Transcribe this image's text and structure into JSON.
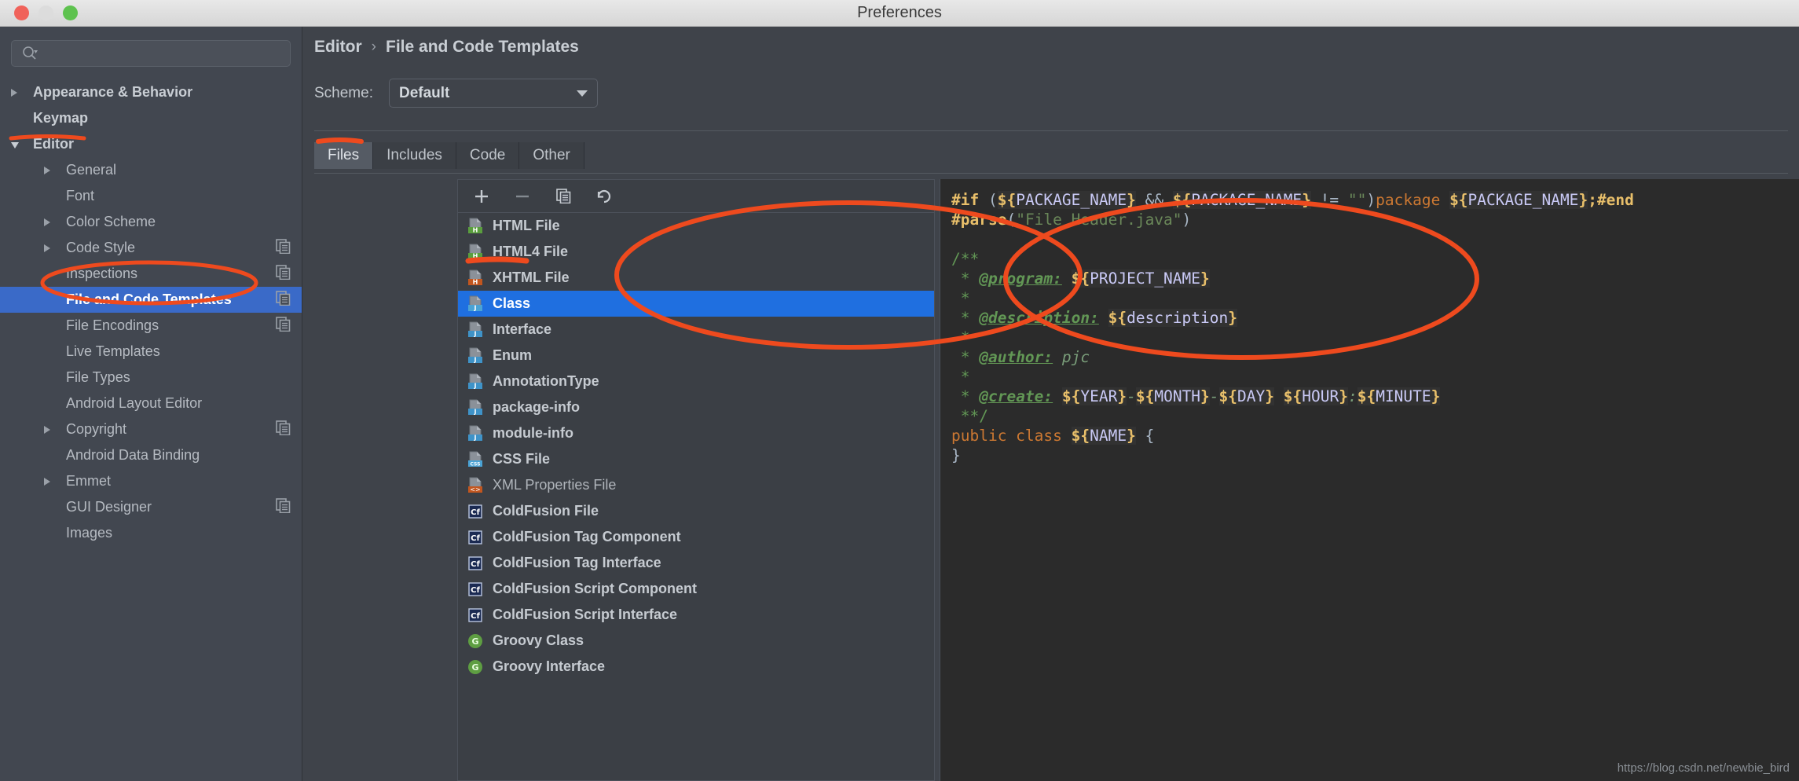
{
  "window": {
    "title": "Preferences",
    "traffic_lights": [
      "close-button",
      "minimize-button",
      "zoom-button"
    ]
  },
  "sidebar": {
    "search": {
      "value": "",
      "placeholder": ""
    },
    "items": [
      {
        "label": "Appearance & Behavior",
        "indent": 0,
        "arrow": "right",
        "bold": true,
        "selected": false,
        "copy": false
      },
      {
        "label": "Keymap",
        "indent": 0,
        "arrow": "none",
        "bold": true,
        "selected": false,
        "copy": false
      },
      {
        "label": "Editor",
        "indent": 0,
        "arrow": "down",
        "bold": true,
        "selected": false,
        "copy": false
      },
      {
        "label": "General",
        "indent": 1,
        "arrow": "right",
        "bold": false,
        "selected": false,
        "copy": false
      },
      {
        "label": "Font",
        "indent": 1,
        "arrow": "none",
        "bold": false,
        "selected": false,
        "copy": false
      },
      {
        "label": "Color Scheme",
        "indent": 1,
        "arrow": "right",
        "bold": false,
        "selected": false,
        "copy": false
      },
      {
        "label": "Code Style",
        "indent": 1,
        "arrow": "right",
        "bold": false,
        "selected": false,
        "copy": true
      },
      {
        "label": "Inspections",
        "indent": 1,
        "arrow": "none",
        "bold": false,
        "selected": false,
        "copy": true
      },
      {
        "label": "File and Code Templates",
        "indent": 1,
        "arrow": "none",
        "bold": false,
        "selected": true,
        "copy": true
      },
      {
        "label": "File Encodings",
        "indent": 1,
        "arrow": "none",
        "bold": false,
        "selected": false,
        "copy": true
      },
      {
        "label": "Live Templates",
        "indent": 1,
        "arrow": "none",
        "bold": false,
        "selected": false,
        "copy": false
      },
      {
        "label": "File Types",
        "indent": 1,
        "arrow": "none",
        "bold": false,
        "selected": false,
        "copy": false
      },
      {
        "label": "Android Layout Editor",
        "indent": 1,
        "arrow": "none",
        "bold": false,
        "selected": false,
        "copy": false
      },
      {
        "label": "Copyright",
        "indent": 1,
        "arrow": "right",
        "bold": false,
        "selected": false,
        "copy": true
      },
      {
        "label": "Android Data Binding",
        "indent": 1,
        "arrow": "none",
        "bold": false,
        "selected": false,
        "copy": false
      },
      {
        "label": "Emmet",
        "indent": 1,
        "arrow": "right",
        "bold": false,
        "selected": false,
        "copy": false
      },
      {
        "label": "GUI Designer",
        "indent": 1,
        "arrow": "none",
        "bold": false,
        "selected": false,
        "copy": true
      },
      {
        "label": "Images",
        "indent": 1,
        "arrow": "none",
        "bold": false,
        "selected": false,
        "copy": false
      }
    ]
  },
  "main": {
    "breadcrumb": {
      "parent": "Editor",
      "separator": "›",
      "current": "File and Code Templates"
    },
    "scheme": {
      "label": "Scheme:",
      "value": "Default"
    },
    "tabs": [
      {
        "label": "Files",
        "active": true
      },
      {
        "label": "Includes",
        "active": false
      },
      {
        "label": "Code",
        "active": false
      },
      {
        "label": "Other",
        "active": false
      }
    ],
    "toolbar": [
      {
        "name": "add-template-button",
        "glyph": "+"
      },
      {
        "name": "remove-template-button",
        "glyph": "−"
      },
      {
        "name": "copy-template-button",
        "glyph": "copy"
      },
      {
        "name": "reset-template-button",
        "glyph": "undo"
      }
    ],
    "templates": [
      {
        "label": "HTML File",
        "icon": "html-file-icon",
        "icon_kind": "page",
        "badge": "H",
        "badge_color": "#5a9e3e",
        "selected": false
      },
      {
        "label": "HTML4 File",
        "icon": "html4-file-icon",
        "icon_kind": "page",
        "badge": "H",
        "badge_color": "#5a9e3e",
        "selected": false
      },
      {
        "label": "XHTML File",
        "icon": "xhtml-file-icon",
        "icon_kind": "page",
        "badge": "H",
        "badge_color": "#c2561f",
        "selected": false
      },
      {
        "label": "Class",
        "icon": "java-class-icon",
        "icon_kind": "page",
        "badge": "J",
        "badge_color": "#4aa3d6",
        "selected": true
      },
      {
        "label": "Interface",
        "icon": "java-interface-icon",
        "icon_kind": "page",
        "badge": "J",
        "badge_color": "#3f93c8",
        "selected": false
      },
      {
        "label": "Enum",
        "icon": "java-enum-icon",
        "icon_kind": "page",
        "badge": "J",
        "badge_color": "#3f93c8",
        "selected": false
      },
      {
        "label": "AnnotationType",
        "icon": "java-annotation-icon",
        "icon_kind": "page",
        "badge": "J",
        "badge_color": "#3f93c8",
        "selected": false
      },
      {
        "label": "package-info",
        "icon": "package-info-icon",
        "icon_kind": "page",
        "badge": "J",
        "badge_color": "#3f93c8",
        "selected": false
      },
      {
        "label": "module-info",
        "icon": "module-info-icon",
        "icon_kind": "page",
        "badge": "J",
        "badge_color": "#3f93c8",
        "selected": false
      },
      {
        "label": "CSS File",
        "icon": "css-file-icon",
        "icon_kind": "page",
        "badge": "CSS",
        "badge_color": "#4aa3d6",
        "selected": false
      },
      {
        "label": "XML Properties File",
        "icon": "xml-properties-icon",
        "icon_kind": "page",
        "badge": "<>",
        "badge_color": "#c2561f",
        "selected": false,
        "dim": true
      },
      {
        "label": "ColdFusion File",
        "icon": "coldfusion-icon",
        "icon_kind": "cf",
        "badge": "Cf",
        "badge_color": "#1b2a52",
        "selected": false
      },
      {
        "label": "ColdFusion Tag Component",
        "icon": "coldfusion-icon",
        "icon_kind": "cf",
        "badge": "Cf",
        "badge_color": "#1b2a52",
        "selected": false
      },
      {
        "label": "ColdFusion Tag Interface",
        "icon": "coldfusion-icon",
        "icon_kind": "cf",
        "badge": "Cf",
        "badge_color": "#1b2a52",
        "selected": false
      },
      {
        "label": "ColdFusion Script Component",
        "icon": "coldfusion-icon",
        "icon_kind": "cf",
        "badge": "Cf",
        "badge_color": "#1b2a52",
        "selected": false
      },
      {
        "label": "ColdFusion Script Interface",
        "icon": "coldfusion-icon",
        "icon_kind": "cf",
        "badge": "Cf",
        "badge_color": "#1b2a52",
        "selected": false
      },
      {
        "label": "Groovy Class",
        "icon": "groovy-icon",
        "icon_kind": "circle",
        "badge": "G",
        "badge_color": "#5e9e42",
        "selected": false
      },
      {
        "label": "Groovy Interface",
        "icon": "groovy-icon",
        "icon_kind": "circle",
        "badge": "G",
        "badge_color": "#5e9e42",
        "selected": false
      }
    ],
    "editor": {
      "lines": [
        "#if (${PACKAGE_NAME} && ${PACKAGE_NAME} != \"\")package ${PACKAGE_NAME};#end",
        "#parse(\"File Header.java\")",
        "",
        "/**",
        " * @program: ${PROJECT_NAME}",
        " *",
        " * @description: ${description}",
        " *",
        " * @author: pjc",
        " *",
        " * @create: ${YEAR}-${MONTH}-${DAY} ${HOUR}:${MINUTE}",
        " **/",
        "public class ${NAME} {",
        "}"
      ]
    }
  },
  "annotations": {
    "color": "#ee4a1e",
    "shapes": [
      "editor-ellipse",
      "sidebar-ellipse",
      "editor-underline",
      "files-tab-underline",
      "class-row-underline"
    ]
  },
  "watermark": "https://blog.csdn.net/newbie_bird"
}
